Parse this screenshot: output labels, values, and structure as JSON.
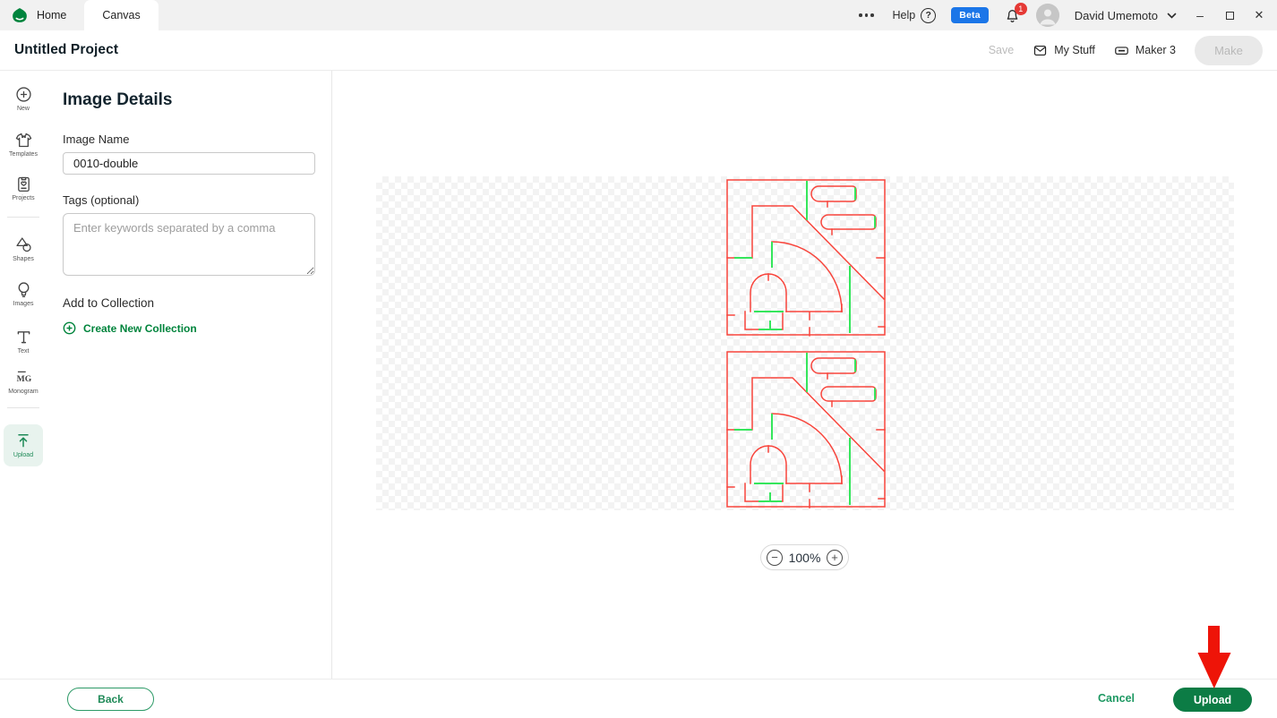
{
  "top_bar": {
    "tabs": [
      {
        "label": "Home"
      },
      {
        "label": "Canvas"
      }
    ],
    "help_label": "Help",
    "beta_label": "Beta",
    "notification_count": "1",
    "user_name": "David Umemoto"
  },
  "header": {
    "project_title": "Untitled Project",
    "save_label": "Save",
    "my_stuff_label": "My Stuff",
    "machine_label": "Maker 3",
    "make_label": "Make"
  },
  "sidebar": {
    "items": [
      {
        "label": "New"
      },
      {
        "label": "Templates"
      },
      {
        "label": "Projects"
      },
      {
        "label": "Shapes"
      },
      {
        "label": "Images"
      },
      {
        "label": "Text"
      },
      {
        "label": "Monogram"
      },
      {
        "label": "Upload",
        "active": true
      }
    ]
  },
  "panel": {
    "title": "Image Details",
    "image_name_label": "Image Name",
    "image_name_value": "0010-double",
    "tags_label": "Tags (optional)",
    "tags_placeholder": "Enter keywords separated by a comma",
    "collection_label": "Add to Collection",
    "create_collection_label": "Create New Collection"
  },
  "canvas": {
    "zoom_level": "100%",
    "artwork_line_color": "#f8453c",
    "artwork_accent_color": "#35e65c"
  },
  "footer": {
    "back_label": "Back",
    "cancel_label": "Cancel",
    "upload_label": "Upload"
  },
  "colors": {
    "brand_green": "#00843d",
    "upload_button_green": "#0c7c45",
    "beta_blue": "#1b76e8",
    "notification_red": "#e53935",
    "annotation_arrow_red": "#ee1408"
  }
}
